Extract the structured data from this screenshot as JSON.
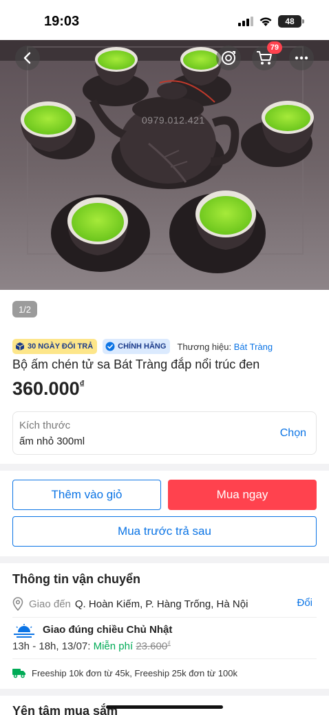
{
  "status_bar": {
    "time": "19:03",
    "battery": "48"
  },
  "hero": {
    "watermark": "0979.012.421",
    "cart_count": "79",
    "icons": {
      "back": "chevron-left-icon",
      "ar": "ar-view-icon",
      "cart": "cart-icon",
      "more": "more-icon"
    }
  },
  "gallery": {
    "page_indicator": "1/2"
  },
  "badges": {
    "return_policy": "30 NGÀY ĐỔI TRẢ",
    "genuine": "CHÍNH HÃNG",
    "brand_label": "Thương hiệu:",
    "brand_name": "Bát Tràng"
  },
  "product": {
    "title": "Bộ ấm chén tử sa Bát Tràng đắp nổi trúc đen",
    "price": "360.000",
    "currency": "₫"
  },
  "variant": {
    "label": "Kích thước",
    "value": "ấm nhỏ 300ml",
    "choose": "Chọn"
  },
  "actions": {
    "add_to_cart": "Thêm vào giỏ",
    "buy_now": "Mua ngay",
    "buy_now_pay_later": "Mua trước trả sau"
  },
  "shipping": {
    "title": "Thông tin vận chuyển",
    "deliver_to_prefix": "Giao đến",
    "address": "Q. Hoàn Kiếm, P. Hàng Trống, Hà Nội",
    "change": "Đổi",
    "delivery_title": "Giao đúng chiều Chủ Nhật",
    "delivery_window": "13h - 18h, 13/07:",
    "free_label": "Miễn phí",
    "original_fee": "23.600",
    "original_fee_currency": "₫",
    "freeship_note": "Freeship 10k đơn từ 45k, Freeship 25k đơn từ 100k"
  },
  "next_section": {
    "title": "Yên tâm mua sắm"
  },
  "colors": {
    "accent_blue": "#0b74e5",
    "buy_red": "#ff424e",
    "free_green": "#00ab56"
  }
}
